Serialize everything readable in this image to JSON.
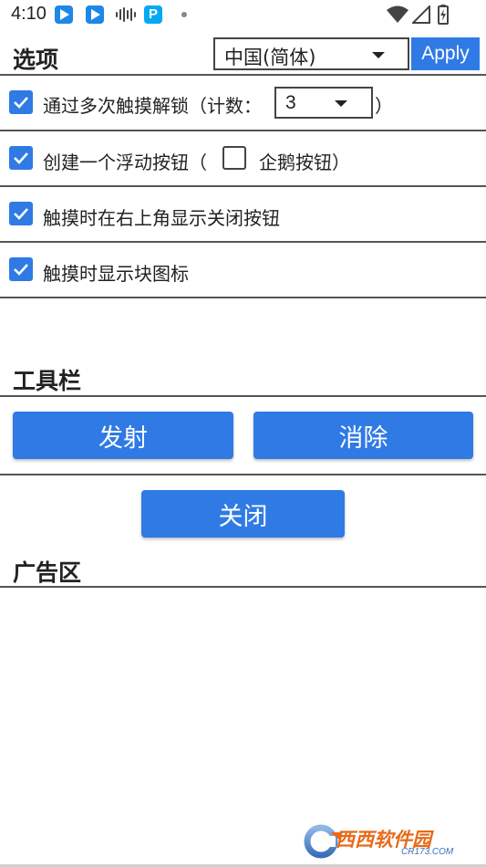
{
  "status_bar": {
    "time": "4:10",
    "icons": [
      "app-icon",
      "app-icon",
      "sound-wave-icon",
      "p-app-icon",
      "dot-icon",
      "wifi-icon",
      "signal-icon",
      "battery-charging-icon"
    ],
    "p_letter": "P"
  },
  "options": {
    "title": "选项",
    "language": {
      "selected": "中国(简体)"
    },
    "apply_label": "Apply",
    "items": [
      {
        "checked": true,
        "label_before": "通过多次触摸解锁（计数：",
        "count_value": "3",
        "label_after": "）"
      },
      {
        "checked": true,
        "label_before": "创建一个浮动按钮（",
        "sub_checked": false,
        "sub_label": "企鹅按钮）"
      },
      {
        "checked": true,
        "label": "触摸时在右上角显示关闭按钮"
      },
      {
        "checked": true,
        "label": "触摸时显示块图标"
      }
    ]
  },
  "toolbar": {
    "title": "工具栏",
    "fire_label": "发射",
    "clear_label": "消除",
    "close_label": "关闭"
  },
  "ads": {
    "title": "广告区"
  },
  "watermark": {
    "text": "西西软件园",
    "sub_text": "CR173.COM"
  },
  "colors": {
    "accent": "#2f7ae5",
    "divider": "#555555",
    "text": "#222222"
  }
}
